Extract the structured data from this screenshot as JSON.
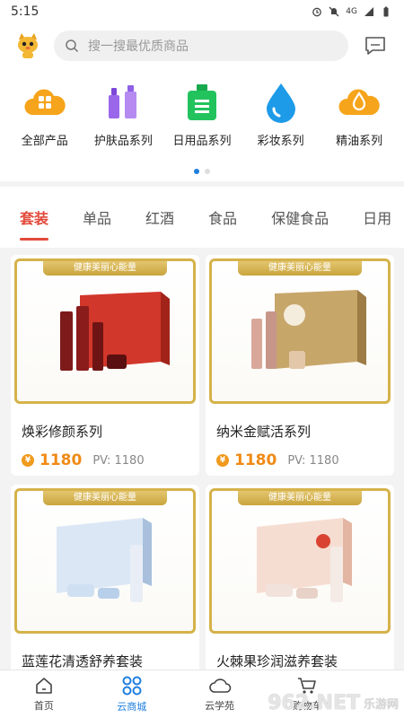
{
  "status_bar": {
    "time": "5:15",
    "network": "4G"
  },
  "search": {
    "placeholder": "搜一搜最优质商品"
  },
  "categories": [
    {
      "label": "全部产品",
      "icon": "grid-cloud-icon",
      "color": "#f6a41b"
    },
    {
      "label": "护肤品系列",
      "icon": "cosmetics-bottles-icon",
      "color": "#8f5fe6"
    },
    {
      "label": "日用品系列",
      "icon": "daily-bottle-icon",
      "color": "#22c35d"
    },
    {
      "label": "彩妆系列",
      "icon": "water-drop-icon",
      "color": "#1e9be8"
    },
    {
      "label": "精油系列",
      "icon": "oil-cloud-icon",
      "color": "#f6a41b"
    }
  ],
  "carousel": {
    "pages": 2,
    "active": 1
  },
  "tabs": [
    "套装",
    "单品",
    "红酒",
    "食品",
    "保健食品",
    "日用"
  ],
  "active_tab": "套装",
  "products": [
    {
      "ribbon": "健康美丽心能量",
      "title": "焕彩修颜系列",
      "price": "1180",
      "pv": "PV: 1180",
      "box_color": "#d2372b"
    },
    {
      "ribbon": "健康美丽心能量",
      "title": "纳米金赋活系列",
      "price": "1180",
      "pv": "PV: 1180",
      "box_color": "#b99457"
    },
    {
      "ribbon": "健康美丽心能量",
      "title": "蓝莲花清透舒养套装",
      "price": "",
      "pv": "",
      "box_color": "#8fb3da"
    },
    {
      "ribbon": "健康美丽心能量",
      "title": "火棘果珍润滋养套装",
      "price": "",
      "pv": "",
      "box_color": "#e7a083"
    }
  ],
  "bottom_nav": [
    {
      "label": "首页",
      "icon": "home-icon"
    },
    {
      "label": "云商城",
      "icon": "mall-icon"
    },
    {
      "label": "云学苑",
      "icon": "cloud-icon"
    },
    {
      "label": "购物车",
      "icon": "cart-icon"
    }
  ],
  "active_nav": "云商城",
  "watermark": {
    "text": "962.NET",
    "sub": "乐游网"
  },
  "colors": {
    "accent_blue": "#1f7fe0",
    "accent_red": "#e24a3b",
    "price_orange": "#f08a16",
    "gold": "#d5b24a"
  }
}
